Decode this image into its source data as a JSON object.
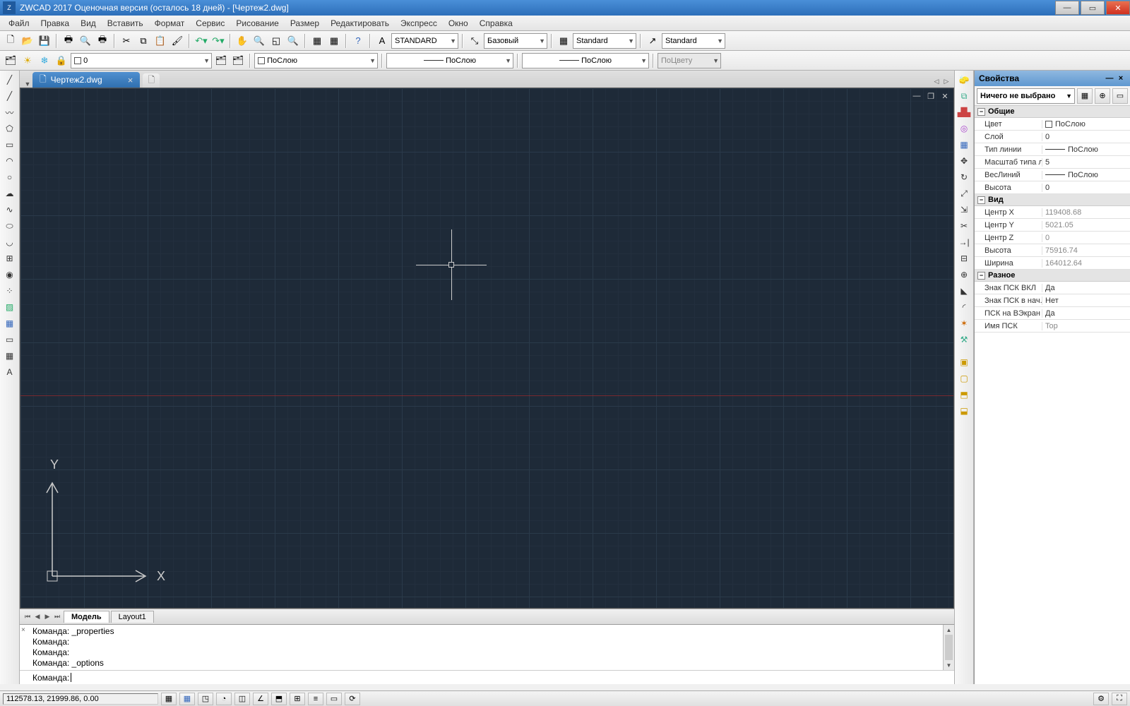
{
  "title": "ZWCAD 2017 Оценочная версия (осталось 18 дней) - [Чертеж2.dwg]",
  "menu": [
    "Файл",
    "Правка",
    "Вид",
    "Вставить",
    "Формат",
    "Сервис",
    "Рисование",
    "Размер",
    "Редактировать",
    "Экспресс",
    "Окно",
    "Справка"
  ],
  "toolbar_combos": {
    "textstyle": "STANDARD",
    "dimstyle": "Базовый",
    "style3": "Standard",
    "style4": "Standard",
    "layer": "0",
    "color": "ПоСлою",
    "linetype": "ПоСлою",
    "lineweight": "ПоСлою",
    "bycolor": "ПоЦвету"
  },
  "file_tab": "Чертеж2.dwg",
  "model_tabs": {
    "active": "Модель",
    "other": "Layout1"
  },
  "command_log": [
    "Команда: _properties",
    "Команда:",
    "Команда:",
    "Команда: _options"
  ],
  "command_prompt": "Команда:",
  "properties": {
    "panel_title": "Свойства",
    "selection": "Ничего не выбрано",
    "categories": [
      {
        "name": "Общие",
        "rows": [
          {
            "k": "Цвет",
            "v": "ПоСлою",
            "swatch": true
          },
          {
            "k": "Слой",
            "v": "0"
          },
          {
            "k": "Тип линии",
            "v": "ПоСлою",
            "line": true
          },
          {
            "k": "Масштаб типа л...",
            "v": "5"
          },
          {
            "k": "ВесЛиний",
            "v": "ПоСлою",
            "line": true
          },
          {
            "k": "Высота",
            "v": "0"
          }
        ]
      },
      {
        "name": "Вид",
        "rows": [
          {
            "k": "Центр X",
            "v": "119408.68",
            "ro": true
          },
          {
            "k": "Центр Y",
            "v": "5021.05",
            "ro": true
          },
          {
            "k": "Центр Z",
            "v": "0",
            "ro": true
          },
          {
            "k": "Высота",
            "v": "75916.74",
            "ro": true
          },
          {
            "k": "Ширина",
            "v": "164012.64",
            "ro": true
          }
        ]
      },
      {
        "name": "Разное",
        "rows": [
          {
            "k": "Знак ПСК ВКЛ",
            "v": "Да"
          },
          {
            "k": "Знак ПСК в нач. ...",
            "v": "Нет"
          },
          {
            "k": "ПСК на ВЭкран",
            "v": "Да"
          },
          {
            "k": "Имя ПСК",
            "v": "Top",
            "ro": true
          }
        ]
      }
    ]
  },
  "status": {
    "coords": "112578.13, 21999.86, 0.00"
  },
  "ucs_labels": {
    "x": "X",
    "y": "Y"
  }
}
